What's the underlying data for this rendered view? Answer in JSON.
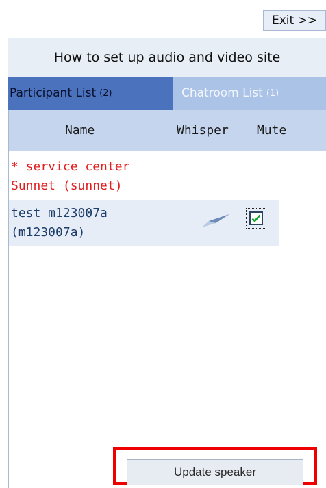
{
  "exit_label": "Exit >>",
  "title": "How to set up audio and video site",
  "tabs": {
    "participant": {
      "label": "Participant List",
      "count": "(2)"
    },
    "chatroom": {
      "label": "Chatroom List",
      "count": "(1)"
    }
  },
  "columns": {
    "name": "Name",
    "whisper": "Whisper",
    "mute": "Mute"
  },
  "participants": [
    {
      "line1": "* service center",
      "line2": "Sunnet (sunnet)",
      "color": "#e02020"
    },
    {
      "line1": "test m123007a",
      "line2": "(m123007a)",
      "color": "#1f3f6b",
      "whisper_icon": "paper-plane-icon",
      "mute_checked": true
    }
  ],
  "update_label": "Update speaker",
  "colors": {
    "active_tab": "#4a72bd",
    "inactive_tab": "#aac3e7",
    "header_bg": "#c5d5ee",
    "highlight": "#ee0000"
  }
}
